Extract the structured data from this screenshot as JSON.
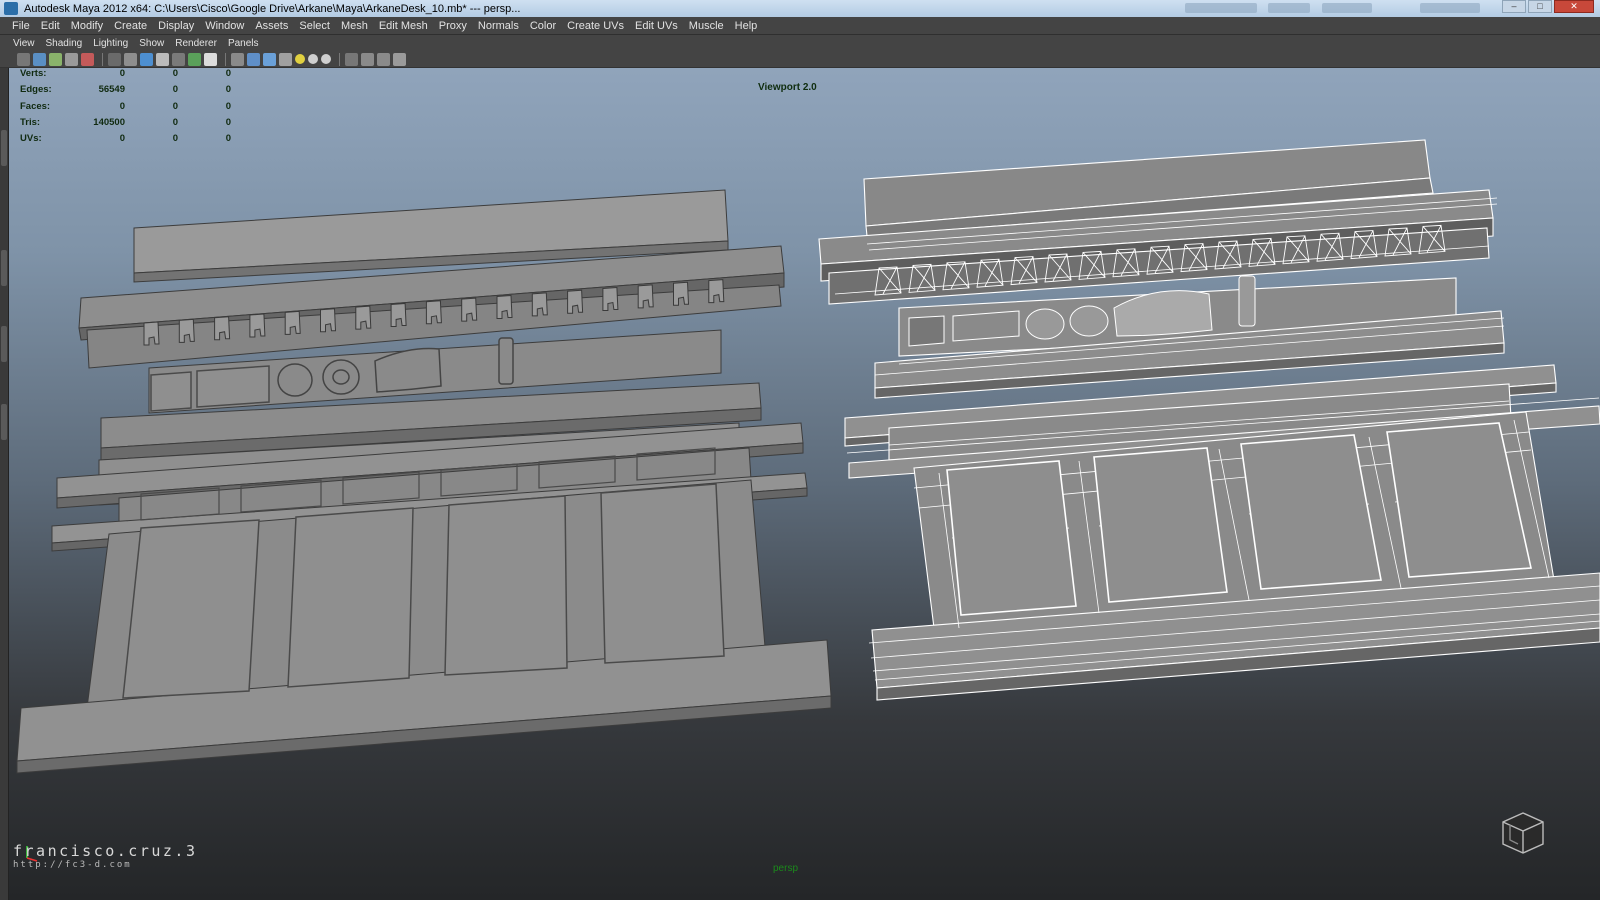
{
  "title_bar": {
    "text": "Autodesk Maya 2012 x64: C:\\Users\\Cisco\\Google Drive\\Arkane\\Maya\\ArkaneDesk_10.mb*  ---  persp..."
  },
  "menubar": {
    "items": [
      "File",
      "Edit",
      "Modify",
      "Create",
      "Display",
      "Window",
      "Assets",
      "Select",
      "Mesh",
      "Edit Mesh",
      "Proxy",
      "Normals",
      "Color",
      "Create UVs",
      "Edit UVs",
      "Muscle",
      "Help"
    ]
  },
  "panel_menu": {
    "items": [
      "View",
      "Shading",
      "Lighting",
      "Show",
      "Renderer",
      "Panels"
    ]
  },
  "toolbar": {
    "icons": [
      "camera-icon",
      "camera-attributes-icon",
      "bookmark-icon",
      "image-plane-icon",
      "2d-pan-icon",
      "grid-icon",
      "film-gate-icon",
      "resolution-gate-icon",
      "gate-mask-icon",
      "field-chart-icon",
      "safe-action-icon",
      "safe-title-icon",
      "wireframe-icon",
      "smooth-shade-icon",
      "wireframe-on-shaded-icon",
      "textured-icon",
      "use-lights-icon",
      "shadows-icon",
      "high-quality-icon",
      "isolate-select-icon",
      "xray-icon",
      "xray-joints-icon",
      "backface-icon"
    ]
  },
  "hud": {
    "rows": [
      {
        "label": "Verts:",
        "values": [
          "0",
          "0",
          "0"
        ]
      },
      {
        "label": "Edges:",
        "values": [
          "56549",
          "0",
          "0"
        ]
      },
      {
        "label": "Faces:",
        "values": [
          "0",
          "0",
          "0"
        ]
      },
      {
        "label": "Tris:",
        "values": [
          "140500",
          "0",
          "0"
        ]
      },
      {
        "label": "UVs:",
        "values": [
          "0",
          "0",
          "0"
        ]
      }
    ],
    "renderer_label": "Viewport 2.0"
  },
  "viewport": {
    "camera_label": "persp",
    "watermark_main": "francisco.cruz.3",
    "watermark_url": "http://fc3-d.com"
  },
  "colors": {
    "hud_text": "#102a10",
    "camera_label": "#1b8a1b",
    "shaded_mesh": "#8a8a8a",
    "wireframe": "#ffffff"
  }
}
